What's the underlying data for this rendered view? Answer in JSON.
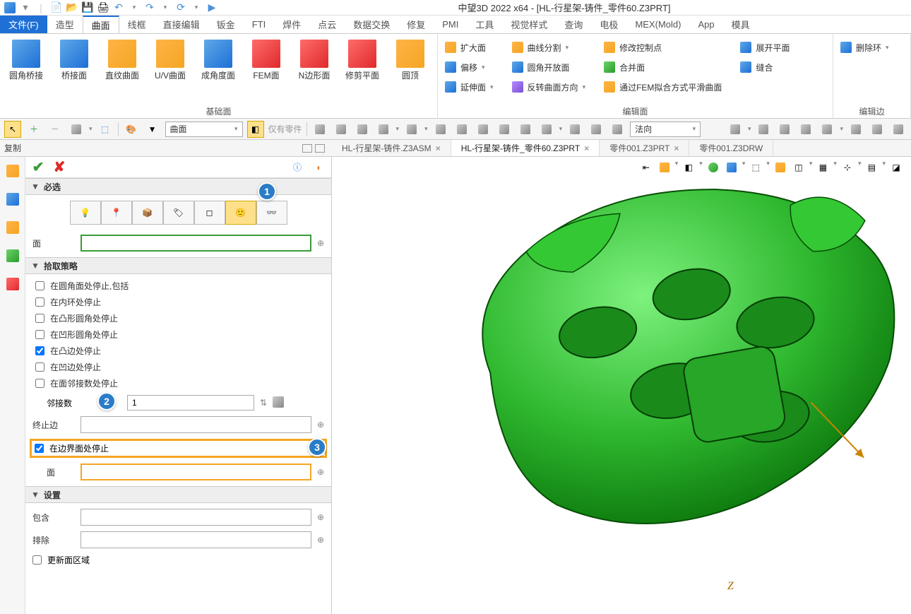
{
  "app": {
    "title": "中望3D 2022 x64 - [HL-行星架-铸件_零件60.Z3PRT]"
  },
  "menu_tabs": [
    "文件(F)",
    "造型",
    "曲面",
    "线框",
    "直接编辑",
    "钣金",
    "FTI",
    "焊件",
    "点云",
    "数据交换",
    "修复",
    "PMI",
    "工具",
    "视觉样式",
    "查询",
    "电极",
    "MEX(Mold)",
    "App",
    "模具"
  ],
  "menu_active_index": 2,
  "ribbon": {
    "group1_label": "基础面",
    "big_buttons": [
      "圆角桥接",
      "桥接面",
      "直纹曲面",
      "U/V曲面",
      "成角度面",
      "FEM面",
      "N边形面",
      "修剪平面",
      "圆顶"
    ],
    "group2_label": "编辑面",
    "col1": [
      "扩大面",
      "偏移",
      "延伸面"
    ],
    "col2": [
      "曲线分割",
      "圆角开放面",
      "反转曲面方向"
    ],
    "col3": [
      "修改控制点",
      "合并面",
      "通过FEM拟合方式平滑曲面"
    ],
    "col4": [
      "展开平面",
      "缝合"
    ],
    "group3_label": "编辑边",
    "col5": [
      "删除环"
    ]
  },
  "toolbar2": {
    "combo1": "曲面",
    "combo2": "仅有零件",
    "combo3": "法向"
  },
  "doc_tabs": {
    "left_label": "复制",
    "items": [
      "HL-行星架-铸件.Z3ASM",
      "HL-行星架-铸件_零件60.Z3PRT",
      "零件001.Z3PRT",
      "零件001.Z3DRW"
    ],
    "active_index": 1
  },
  "panel": {
    "section1_title": "必选",
    "face_label": "面",
    "section2_title": "拾取策略",
    "checks": [
      {
        "label": "在圆角面处停止,包括",
        "checked": false
      },
      {
        "label": "在内环处停止",
        "checked": false
      },
      {
        "label": "在凸形圆角处停止",
        "checked": false
      },
      {
        "label": "在凹形圆角处停止",
        "checked": false
      },
      {
        "label": "在凸边处停止",
        "checked": true
      },
      {
        "label": "在凹边处停止",
        "checked": false
      },
      {
        "label": "在面邻接数处停止",
        "checked": false
      }
    ],
    "adjacency_label": "邻接数",
    "adjacency_value": "1",
    "stop_edge_label": "终止边",
    "boundary_check_label": "在边界面处停止",
    "boundary_face_label": "面",
    "section3_title": "设置",
    "include_label": "包含",
    "exclude_label": "排除",
    "update_check_label": "更新面区域"
  },
  "callouts": {
    "c1": "1",
    "c2": "2",
    "c3": "3"
  },
  "axis": "Z"
}
